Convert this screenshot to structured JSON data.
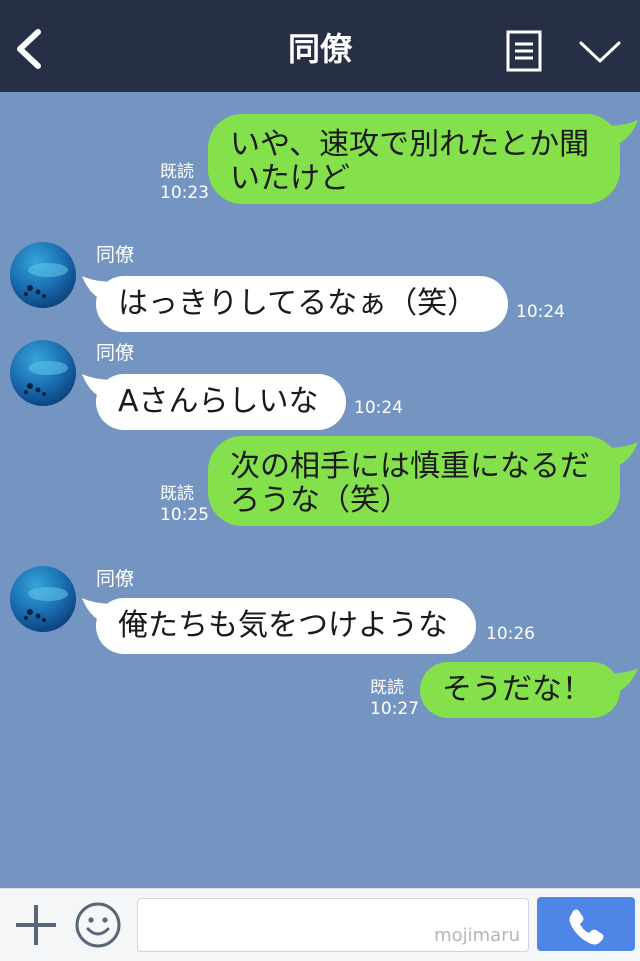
{
  "header": {
    "title": "同僚",
    "back_icon": "chevron-left-icon",
    "menu_icon": "menu-icon",
    "collapse_icon": "chevron-down-icon"
  },
  "messages": [
    {
      "direction": "out",
      "text": "いや、速攻で別れたとか聞いたけど",
      "line1": "いや、速攻で別れたとか聞",
      "line2": "いたけど",
      "read": "既読",
      "time": "10:23"
    },
    {
      "direction": "in",
      "sender": "同僚",
      "text": "はっきりしてるなぁ（笑）",
      "time": "10:24"
    },
    {
      "direction": "in",
      "sender": "同僚",
      "text": "Aさんらしいな",
      "time": "10:24"
    },
    {
      "direction": "out",
      "text": "次の相手には慎重になるだろうな（笑）",
      "line1": "次の相手には慎重になるだ",
      "line2": "ろうな（笑）",
      "read": "既読",
      "time": "10:25"
    },
    {
      "direction": "in",
      "sender": "同僚",
      "text": "俺たちも気をつけような",
      "time": "10:26"
    },
    {
      "direction": "out",
      "text": "そうだな！",
      "read": "既読",
      "time": "10:27"
    }
  ],
  "input_bar": {
    "text_value": "",
    "watermark": "mojimaru",
    "plus_icon": "plus-icon",
    "emoji_icon": "emoji-icon",
    "call_icon": "phone-icon"
  },
  "colors": {
    "header_bg": "#262f45",
    "chat_bg": "#7494c2",
    "outgoing_bubble": "#84e14b",
    "incoming_bubble": "#ffffff",
    "call_button": "#4d86e6"
  }
}
